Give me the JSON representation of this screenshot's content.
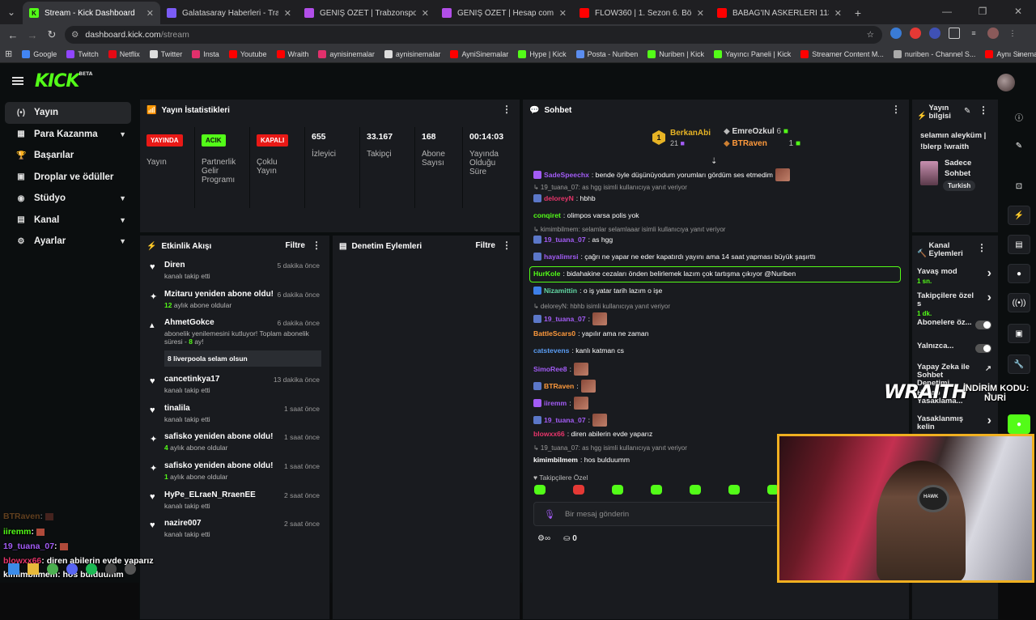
{
  "browser": {
    "tabs": [
      {
        "title": "Stream - Kick Dashboard",
        "fav_color": "#53fc18",
        "fav_text": "K",
        "active": true
      },
      {
        "title": "Galatasaray Haberleri - Transfe",
        "fav_color": "#7b5cf6",
        "fav_text": "",
        "active": false
      },
      {
        "title": "GENİŞ ÖZET | Trabzonspor 3 3",
        "fav_color": "#b14ee8",
        "fav_text": "",
        "active": false
      },
      {
        "title": "GENİŞ ÖZET | Hesap com Antal",
        "fav_color": "#b14ee8",
        "fav_text": "",
        "active": false
      },
      {
        "title": "FLOW360 | 1. Sezon 6. Bölüm |",
        "fav_color": "#ff0000",
        "fav_text": "",
        "active": false
      },
      {
        "title": "BABAG'IN ASKERLERİ 113'ÜN F",
        "fav_color": "#ff0000",
        "fav_text": "",
        "active": false
      }
    ],
    "url_host": "dashboard.kick.com",
    "url_path": "/stream",
    "bookmarks": [
      {
        "label": "Google",
        "color": "#4285f4"
      },
      {
        "label": "Twitch",
        "color": "#9146ff"
      },
      {
        "label": "Netflix",
        "color": "#e50914"
      },
      {
        "label": "Twitter",
        "color": "#dddddd"
      },
      {
        "label": "Insta",
        "color": "#e1306c"
      },
      {
        "label": "Youtube",
        "color": "#ff0000"
      },
      {
        "label": "Wraith",
        "color": "#ff0000"
      },
      {
        "label": "aynisinemalar",
        "color": "#e1306c"
      },
      {
        "label": "aynisinemalar",
        "color": "#dddddd"
      },
      {
        "label": "AyniSinemalar",
        "color": "#ff0000"
      },
      {
        "label": "Hype | Kick",
        "color": "#53fc18"
      },
      {
        "label": "Posta - Nuriben",
        "color": "#5b8def"
      },
      {
        "label": "Nuriben | Kick",
        "color": "#53fc18"
      },
      {
        "label": "Yayıncı Paneli | Kick",
        "color": "#53fc18"
      },
      {
        "label": "Streamer Content M...",
        "color": "#ff0000"
      },
      {
        "label": "nuriben - Channel S...",
        "color": "#aaaaaa"
      },
      {
        "label": "Aynı Sinemalar - Ça...",
        "color": "#ff0000"
      }
    ]
  },
  "sidebar": [
    {
      "label": "Yayın",
      "icon": "(•)",
      "selected": true,
      "chevron": false
    },
    {
      "label": "Para Kazanma",
      "icon": "▦",
      "selected": false,
      "chevron": true
    },
    {
      "label": "Başarılar",
      "icon": "🏆",
      "selected": false,
      "chevron": false
    },
    {
      "label": "Droplar ve ödüller",
      "icon": "▣",
      "selected": false,
      "chevron": false
    },
    {
      "label": "Stüdyo",
      "icon": "◉",
      "selected": false,
      "chevron": true
    },
    {
      "label": "Kanal",
      "icon": "▤",
      "selected": false,
      "chevron": true
    },
    {
      "label": "Ayarlar",
      "icon": "⚙",
      "selected": false,
      "chevron": true
    }
  ],
  "stats": {
    "title": "Yayın İstatistikleri",
    "badges": [
      {
        "badge": "YAYINDA",
        "label": "Yayın",
        "style": "red"
      },
      {
        "badge": "ACIK",
        "label": "Partnerlik Gelir Programı",
        "style": "grn"
      },
      {
        "badge": "KAPALI",
        "label": "Çoklu Yayın",
        "style": "red"
      }
    ],
    "values": [
      {
        "value": "655",
        "label": "İzleyici"
      },
      {
        "value": "33.167",
        "label": "Takipçi"
      },
      {
        "value": "168",
        "label": "Abone Sayısı"
      },
      {
        "value": "00:14:03",
        "label": "Yayında Olduğu Süre"
      }
    ]
  },
  "activity": {
    "title": "Etkinlik Akışı",
    "filter": "Filtre",
    "events": [
      {
        "name": "Diren",
        "sub": "kanalı takip etti",
        "time": "5 dakika önce",
        "icon": "♥"
      },
      {
        "name": "Mzitaru yeniden abone oldu!",
        "sub_num": "12",
        "sub": "aylık abone oldular",
        "time": "6 dakika önce",
        "icon": "✦"
      },
      {
        "name": "AhmetGokce",
        "sub": "abonelik yenilemesini kutluyor! Toplam abonelik süresi - ",
        "sub_num": "8",
        "sub_tail": " ay!",
        "msg": "8 liverpoola selam olsun",
        "time": "6 dakika önce",
        "icon": "▴"
      },
      {
        "name": "cancetinkya17",
        "sub": "kanalı takip etti",
        "time": "13 dakika önce",
        "icon": "♥"
      },
      {
        "name": "tinalila",
        "sub": "kanalı takip etti",
        "time": "1 saat önce",
        "icon": "♥"
      },
      {
        "name": "safisko yeniden abone oldu!",
        "sub_num": "4",
        "sub": "aylık abone oldular",
        "time": "1 saat önce",
        "icon": "✦"
      },
      {
        "name": "safisko yeniden abone oldu!",
        "sub_num": "1",
        "sub": "aylık abone oldular",
        "time": "1 saat önce",
        "icon": "✦"
      },
      {
        "name": "HyPe_ELraeN_RraenEE",
        "sub": "kanalı takip etti",
        "time": "2 saat önce",
        "icon": "♥"
      },
      {
        "name": "nazire007",
        "sub": "kanalı takip etti",
        "time": "2 saat önce",
        "icon": "♥"
      }
    ]
  },
  "moderation": {
    "title": "Denetim Eylemleri",
    "filter": "Filtre"
  },
  "chat": {
    "title": "Sohbet",
    "leaders": {
      "first": {
        "name": "BerkanAbi",
        "count": "21",
        "rank": "1"
      },
      "second": {
        "name": "EmreOzkul",
        "count": "6"
      },
      "third": {
        "name": "BTRaven",
        "count": "1"
      }
    },
    "messages": [
      {
        "user": "SadeSpeechx",
        "color": "#a35cf6",
        "text": ": bende öyle düşünüyodum yorumları gördüm ses etmedim",
        "badge": "i",
        "emote": true
      },
      {
        "reply": "19_tuana_07: as hgg isimli kullanıcıya yanıt veriyor"
      },
      {
        "user": "deloreyN",
        "color": "#e9356b",
        "text": ": hbhb",
        "badge": "m"
      },
      {
        "user": "conqiret",
        "color": "#53fc18",
        "text": ": olimpos varsa polis yok"
      },
      {
        "reply": "kimimbilmem: selamlar selamlaaar isimli kullanıcıya yanıt veriyor"
      },
      {
        "user": "19_tuana_07",
        "color": "#a35cf6",
        "text": ": as hgg",
        "badge": "m"
      },
      {
        "user": "hayalimrsi",
        "color": "#a35cf6",
        "text": ": çağrı ne yapar ne eder kapatırdı yayını ama 14 saat yapması büyük şaşırttı",
        "badge": "m"
      },
      {
        "user": "HurKole",
        "color": "#53fc18",
        "text": ": bidahakine cezaları önden belirlemek lazım çok tartışma çıkıyor @Nuriben"
      },
      {
        "user": "Nizamittin",
        "color": "#62d6a4",
        "text": ": o iş yatar tarih lazım o işe",
        "badge": "v"
      },
      {
        "reply": "deloreyN: hbhb isimli kullanıcıya yanıt veriyor"
      },
      {
        "user": "19_tuana_07",
        "color": "#a35cf6",
        "text": ":",
        "badge": "m",
        "emote": true
      },
      {
        "user": "BattleScars0",
        "color": "#ff9a3c",
        "text": ": yapılır ama ne zaman"
      },
      {
        "user": "catstevens",
        "color": "#5b9ef5",
        "text": ": kanlı katman cs"
      },
      {
        "user": "SimoRee8",
        "color": "#a35cf6",
        "text": ":",
        "emote": true
      },
      {
        "user": "BTRaven",
        "color": "#ff9a3c",
        "text": ":",
        "badge": "m",
        "emote": true
      },
      {
        "user": "iiremm",
        "color": "#a35cf6",
        "text": ":",
        "badge": "i",
        "emote": true
      },
      {
        "user": "19_tuana_07",
        "color": "#a35cf6",
        "text": ":",
        "badge": "m",
        "emote": true
      },
      {
        "user": "blowxx66",
        "color": "#e9356b",
        "text": ": diren abilerin evde yaparız"
      },
      {
        "reply": "19_tuana_07: as hgg isimli kullanıcıya yanıt veriyor"
      },
      {
        "user": "kimimbilmem",
        "color": "#ffffff",
        "text": ": hos bulduumm"
      }
    ],
    "followers_only": "Takipçilere Özel",
    "placeholder": "Bir mesaj gönderin",
    "points": "0"
  },
  "streaminfo": {
    "title": "Yayın bilgisi",
    "text": "selamın aleyküm | !blerp !wraith",
    "category": "Sadece Sohbet",
    "lang": "Turkish"
  },
  "channel_actions": {
    "title": "Kanal Eylemleri",
    "items": [
      {
        "label": "Yavaş mod",
        "sub": "1 sn.",
        "type": "chev"
      },
      {
        "label": "Takipçilere özel s",
        "sub": "1 dk.",
        "type": "chev"
      },
      {
        "label": "Abonelere öz...",
        "type": "toggle"
      },
      {
        "label": "Yalnızca...",
        "type": "toggle"
      },
      {
        "label": "Yapay Zeka ile Sohbet Denetimi",
        "type": "ext"
      },
      {
        "label": "Hesap Yasaklama...",
        "type": "chev"
      },
      {
        "label": "Yasaklanmış kelin",
        "type": "chev"
      }
    ]
  },
  "overlay": {
    "chat": [
      {
        "user": "BTRaven",
        "color": "#ff9a3c",
        "text": ":"
      },
      {
        "user": "iiremm",
        "color": "#53fc18",
        "text": ":"
      },
      {
        "user": "19_tuana_07",
        "color": "#a35cf6",
        "text": ":"
      },
      {
        "user": "blowxx66",
        "color": "#e9356b",
        "text": ": diren abilerin evde yaparız"
      },
      {
        "user": "kimimbilmem",
        "color": "#ffffff",
        "text": ": hos bulduumm"
      }
    ],
    "wraith": "WRAITH",
    "promo": "İNDİRİM KODU:",
    "code": "NURİ",
    "headset": "HAWK"
  },
  "colors": {
    "kick_green": "#53fc18",
    "panel": "#191b1f",
    "bg": "#0b0e0f"
  }
}
